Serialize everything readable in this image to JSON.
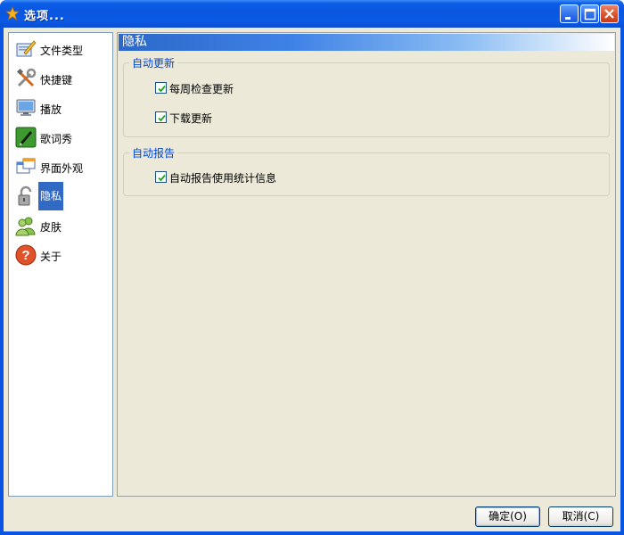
{
  "window": {
    "title": "选项...",
    "icons": {
      "app": "star-icon",
      "minimize": "minimize-icon",
      "maximize": "maximize-icon",
      "close": "close-icon"
    }
  },
  "sidebar": {
    "items": [
      {
        "label": "文件类型",
        "icon": "file-types-icon"
      },
      {
        "label": "快捷键",
        "icon": "tools-icon"
      },
      {
        "label": "播放",
        "icon": "monitor-icon"
      },
      {
        "label": "歌词秀",
        "icon": "pen-icon"
      },
      {
        "label": "界面外观",
        "icon": "windows-icon"
      },
      {
        "label": "隐私",
        "icon": "lock-icon",
        "selected": true
      },
      {
        "label": "皮肤",
        "icon": "users-icon"
      },
      {
        "label": "关于",
        "icon": "help-icon"
      }
    ]
  },
  "main": {
    "header": "隐私",
    "groups": [
      {
        "legend": "自动更新",
        "options": [
          {
            "label": "每周检查更新",
            "checked": true
          },
          {
            "label": "下载更新",
            "checked": true
          }
        ]
      },
      {
        "legend": "自动报告",
        "options": [
          {
            "label": "自动报告使用统计信息",
            "checked": true
          }
        ]
      }
    ]
  },
  "footer": {
    "ok_label": "确定(O)",
    "cancel_label": "取消(C)"
  },
  "colors": {
    "titlebar": "#0a56e0",
    "selection": "#316ac5",
    "legend_text": "#0046d5",
    "dialog_bg": "#ece9d8"
  }
}
